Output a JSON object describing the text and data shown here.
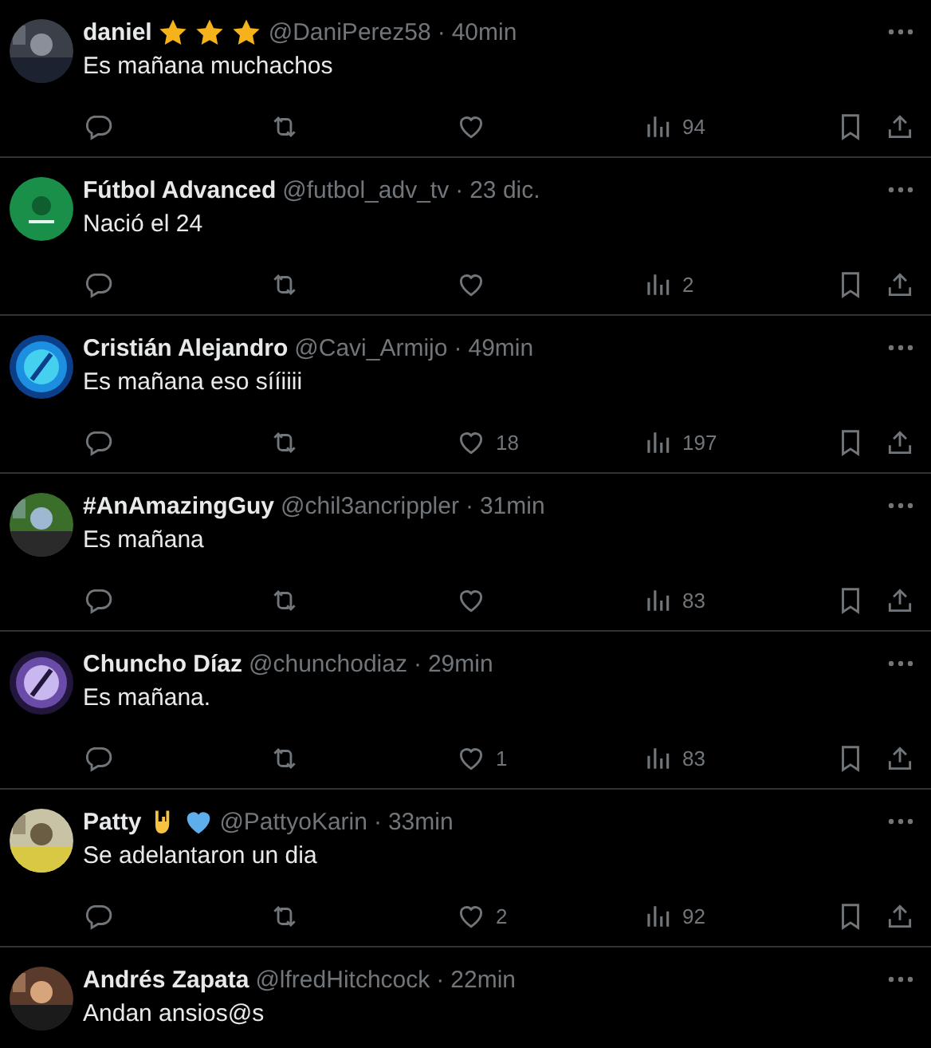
{
  "tweets": [
    {
      "name": "daniel",
      "badges": [
        {
          "kind": "star"
        },
        {
          "kind": "star"
        },
        {
          "kind": "star"
        }
      ],
      "handle": "@DaniPerez58",
      "sep": "·",
      "time": "40min",
      "text": "Es mañana muchachos",
      "views": "94"
    },
    {
      "name": "Fútbol Advanced",
      "handle": "@futbol_adv_tv",
      "sep": "·",
      "time": "23 dic.",
      "text": "Nació el 24",
      "views": "2"
    },
    {
      "name": "Cristián Alejandro",
      "handle": "@Cavi_Armijo",
      "sep": "·",
      "time": "49min",
      "text": "Es mañana eso sííiiii",
      "likes": "18",
      "views": "197"
    },
    {
      "name": "#AnAmazingGuy",
      "handle": "@chil3ancrippler",
      "sep": "·",
      "time": "31min",
      "text": "Es mañana",
      "views": "83"
    },
    {
      "name": "Chuncho Díaz",
      "handle": "@chunchodiaz",
      "sep": "·",
      "time": "29min",
      "text": "Es mañana.",
      "likes": "1",
      "views": "83"
    },
    {
      "name": "Patty",
      "badges": [
        {
          "kind": "rock-hand"
        },
        {
          "kind": "heart"
        }
      ],
      "handle": "@PattyoKarin",
      "sep": "·",
      "time": "33min",
      "text": "Se adelantaron un dia",
      "likes": "2",
      "views": "92"
    },
    {
      "name": "Andrés Zapata",
      "handle": "@lfredHitchcock",
      "sep": "·",
      "time": "22min",
      "text": "Andan ansios@s"
    }
  ]
}
